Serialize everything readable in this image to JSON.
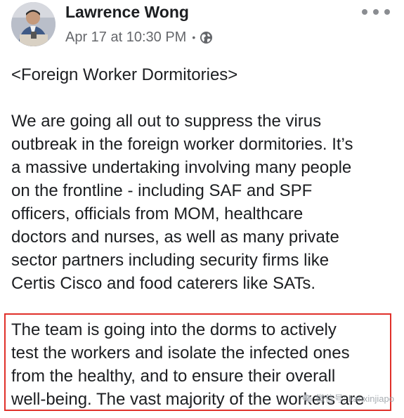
{
  "post": {
    "author": {
      "name": "Lawrence Wong"
    },
    "timestamp": "Apr 17 at 10:30 PM",
    "separator": "•",
    "audience_icon": "globe-icon",
    "more_icon": "more-options-icon",
    "heading": "<Foreign Worker Dormitories>",
    "paragraph1": [
      "We are going all out to suppress the virus",
      "outbreak in the foreign worker dormitories.  It’s",
      "a massive undertaking involving many people",
      "on the frontline - including SAF and SPF",
      "officers, officials from MOM, healthcare",
      "doctors and nurses, as well as many private",
      "sector partners including security firms like",
      "Certis Cisco and food caterers like SATs."
    ],
    "paragraph2": [
      "The team is going into the dorms to actively",
      "test the workers and isolate the infected ones",
      "from the healthy, and to ensure their overall",
      "well-being. The vast majority of the workers are"
    ]
  },
  "watermark": {
    "text": "微信号: kanxinjiapo",
    "icon": "wechat-icon"
  },
  "colors": {
    "text": "#1c1e21",
    "secondary": "#65676b",
    "highlight_border": "#e0302a"
  }
}
